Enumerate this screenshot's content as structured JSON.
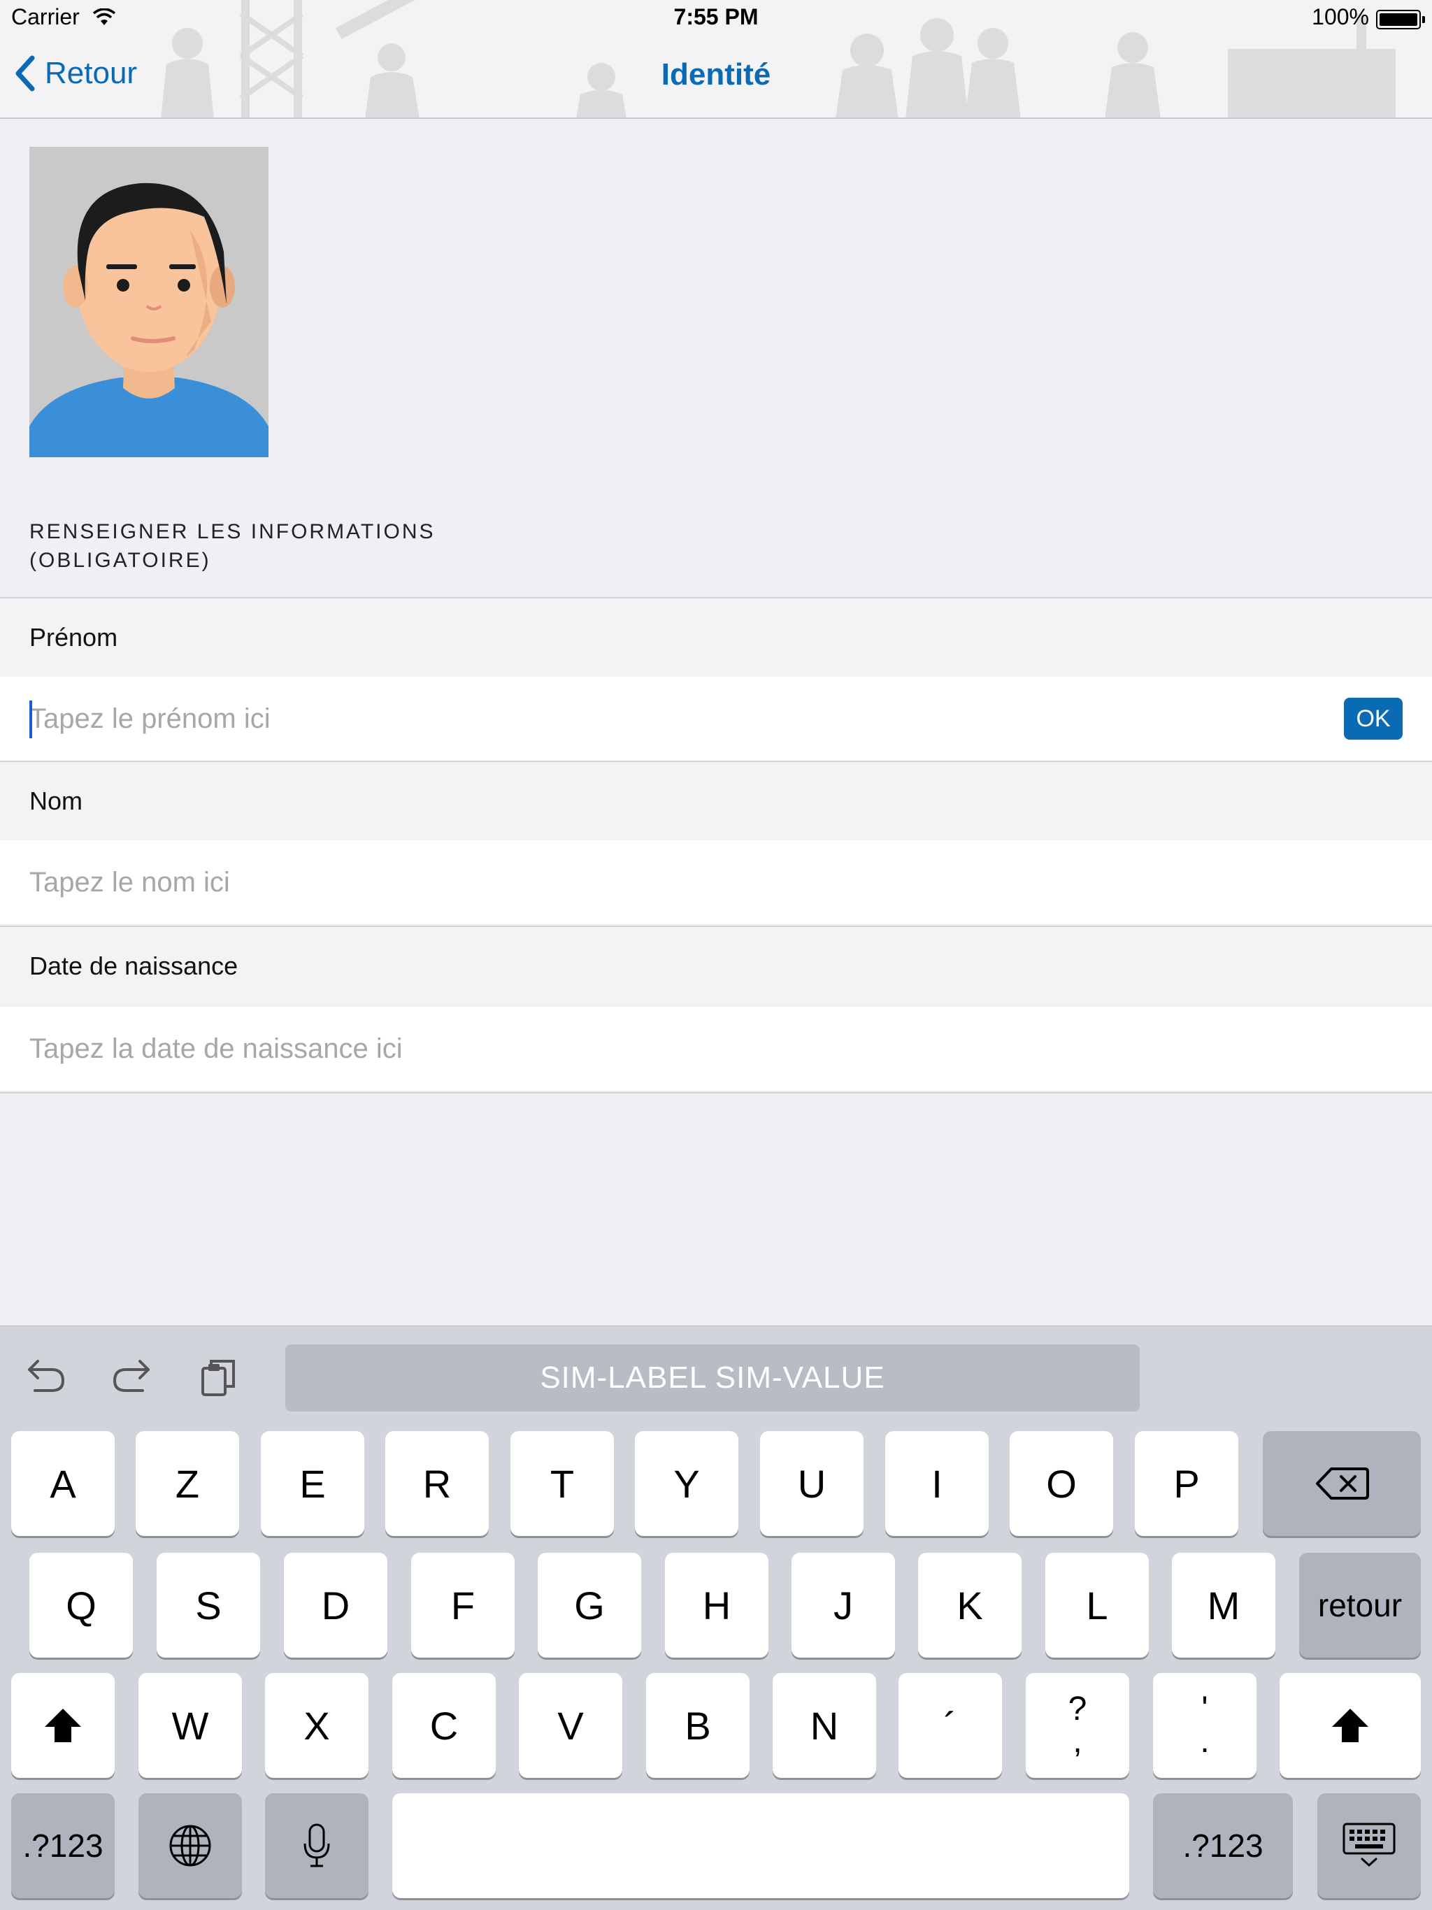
{
  "status_bar": {
    "carrier": "Carrier",
    "time": "7:55 PM",
    "battery": "100%"
  },
  "nav": {
    "back_label": "Retour",
    "title": "Identité"
  },
  "form": {
    "section_header_line1": "RENSEIGNER LES INFORMATIONS",
    "section_header_line2": "(OBLIGATOIRE)",
    "fields": [
      {
        "label": "Prénom",
        "placeholder": "Tapez le prénom ici",
        "value": ""
      },
      {
        "label": "Nom",
        "placeholder": "Tapez le nom ici",
        "value": ""
      },
      {
        "label": "Date de naissance",
        "placeholder": "Tapez la date de naissance ici",
        "value": ""
      }
    ],
    "ok_label": "OK"
  },
  "keyboard": {
    "suggestion": "SIM-LABEL SIM-VALUE",
    "row1": [
      "A",
      "Z",
      "E",
      "R",
      "T",
      "Y",
      "U",
      "I",
      "O",
      "P"
    ],
    "row2": [
      "Q",
      "S",
      "D",
      "F",
      "G",
      "H",
      "J",
      "K",
      "L",
      "M"
    ],
    "return_label": "retour",
    "row3": [
      "W",
      "X",
      "C",
      "V",
      "B",
      "N",
      "´"
    ],
    "punct1_top": "?",
    "punct1_bottom": ",",
    "punct2_top": "'",
    "punct2_bottom": ".",
    "numbers_label": ".?123"
  },
  "colors": {
    "accent": "#0a6ab4",
    "background": "#efeff4",
    "keyboard_bg": "#d1d4da"
  }
}
